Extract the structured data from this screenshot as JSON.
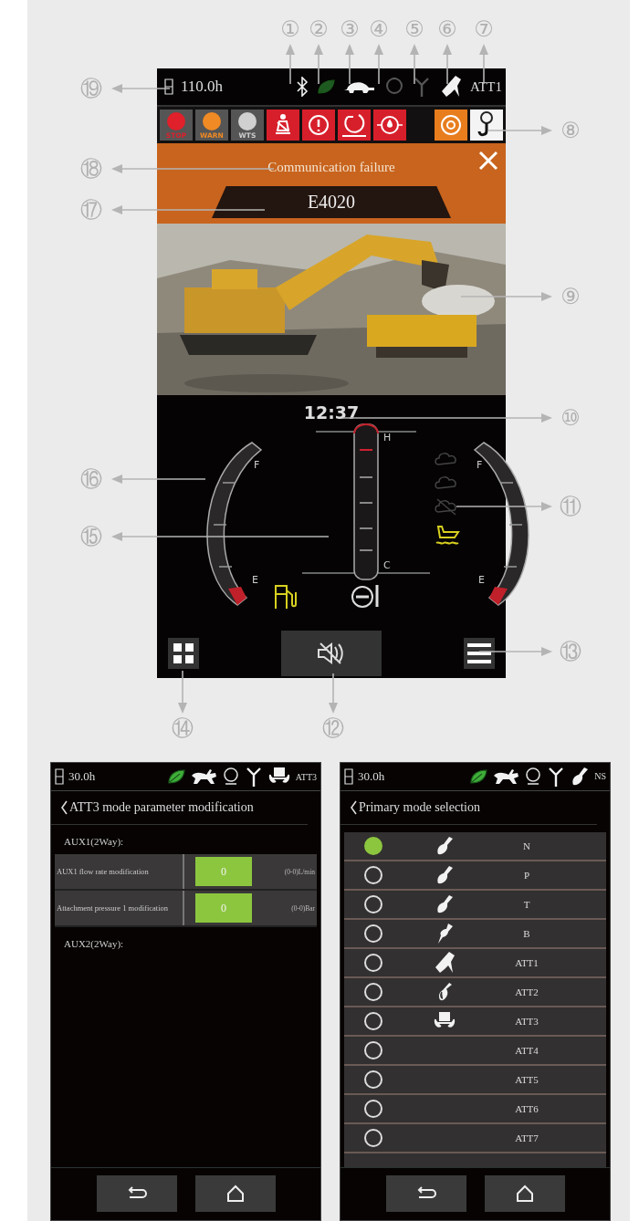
{
  "callouts": [
    {
      "number": "①"
    },
    {
      "number": "②"
    },
    {
      "number": "③"
    },
    {
      "number": "④"
    },
    {
      "number": "⑤"
    },
    {
      "number": "⑥"
    },
    {
      "number": "⑦"
    },
    {
      "number": "⑲"
    },
    {
      "number": "⑧"
    },
    {
      "number": "⑱"
    },
    {
      "number": "⑰"
    },
    {
      "number": "⑨"
    },
    {
      "number": "⑩"
    },
    {
      "number": "⑯"
    },
    {
      "number": "⑪"
    },
    {
      "number": "⑮"
    },
    {
      "number": "⑬"
    },
    {
      "number": "⑭"
    },
    {
      "number": "⑫"
    }
  ],
  "main_screen": {
    "status_bar": {
      "hours": "110.0h",
      "mode": "ATT1"
    },
    "warning_lights": [
      {
        "label": "STOP",
        "color": "#e0202a"
      },
      {
        "label": "WARN",
        "color": "#f08a24"
      },
      {
        "label": "WTS",
        "color": "#d0d0d0"
      }
    ],
    "alert_banner": {
      "message": "Communication failure",
      "code": "E4020"
    },
    "clock": "12:37",
    "fuel_gauge": {
      "full": "F",
      "empty": "E"
    },
    "coolant_gauge": {
      "hot": "H",
      "cold": "C"
    },
    "def_gauge": {
      "full": "F",
      "empty": "E"
    }
  },
  "param_screen": {
    "status_bar": {
      "hours": "30.0h",
      "mode": "ATT3"
    },
    "title": "ATT3 mode parameter modification",
    "sections": [
      {
        "heading": "AUX1(2Way):",
        "rows": [
          {
            "label": "AUX1 flow rate  modification",
            "value": "0",
            "range": "(0-0)L/min"
          },
          {
            "label": "Attachment pressure 1 modification",
            "value": "0",
            "range": "(0-0)Bar"
          }
        ]
      },
      {
        "heading": "AUX2(2Way):"
      }
    ]
  },
  "mode_screen": {
    "status_bar": {
      "hours": "30.0h",
      "mode": "NS"
    },
    "title": "Primary mode selection",
    "modes": [
      {
        "label": "N",
        "kind": "bucket",
        "selected": true
      },
      {
        "label": "P",
        "kind": "bucket",
        "selected": false
      },
      {
        "label": "T",
        "kind": "bucket",
        "selected": false
      },
      {
        "label": "B",
        "kind": "breaker",
        "selected": false
      },
      {
        "label": "ATT1",
        "kind": "claw",
        "selected": false
      },
      {
        "label": "ATT2",
        "kind": "shear",
        "selected": false
      },
      {
        "label": "ATT3",
        "kind": "rotator",
        "selected": false
      },
      {
        "label": "ATT4",
        "kind": "plain",
        "selected": false
      },
      {
        "label": "ATT5",
        "kind": "plain",
        "selected": false
      },
      {
        "label": "ATT6",
        "kind": "plain",
        "selected": false
      },
      {
        "label": "ATT7",
        "kind": "plain",
        "selected": false
      }
    ]
  }
}
